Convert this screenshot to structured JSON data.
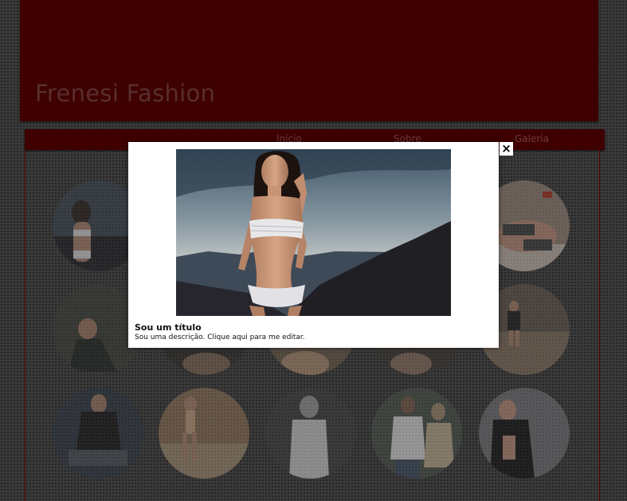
{
  "site": {
    "title": "Frenesi Fashion"
  },
  "nav": {
    "items": [
      {
        "label": "Início"
      },
      {
        "label": "Sobre"
      },
      {
        "label": "Galeria"
      }
    ]
  },
  "gallery": {
    "thumbnails": [
      {
        "row": 1,
        "col": 1,
        "tone": "#3b4450"
      },
      {
        "row": 1,
        "col": 5,
        "tone": "#8a7a6e"
      },
      {
        "row": 2,
        "col": 1,
        "tone": "#3a3d36"
      },
      {
        "row": 2,
        "col": 2,
        "tone": "#2d2a27"
      },
      {
        "row": 2,
        "col": 3,
        "tone": "#6b5a48"
      },
      {
        "row": 2,
        "col": 4,
        "tone": "#3a3430"
      },
      {
        "row": 2,
        "col": 5,
        "tone": "#5b5048"
      },
      {
        "row": 3,
        "col": 1,
        "tone": "#2d3540"
      },
      {
        "row": 3,
        "col": 2,
        "tone": "#8a6f55"
      },
      {
        "row": 3,
        "col": 3,
        "tone": "#3c3c3c"
      },
      {
        "row": 3,
        "col": 4,
        "tone": "#4a5048"
      },
      {
        "row": 3,
        "col": 5,
        "tone": "#6b6b70"
      }
    ]
  },
  "lightbox": {
    "close_label": "×",
    "title": "Sou um título",
    "description": "Sou uma descrição. Clique aqui para me editar."
  },
  "colors": {
    "header_bg": "#3e0000",
    "nav_bg": "#3e0000",
    "page_bg": "#3a3a3a",
    "title_text": "#5a2e2e"
  }
}
